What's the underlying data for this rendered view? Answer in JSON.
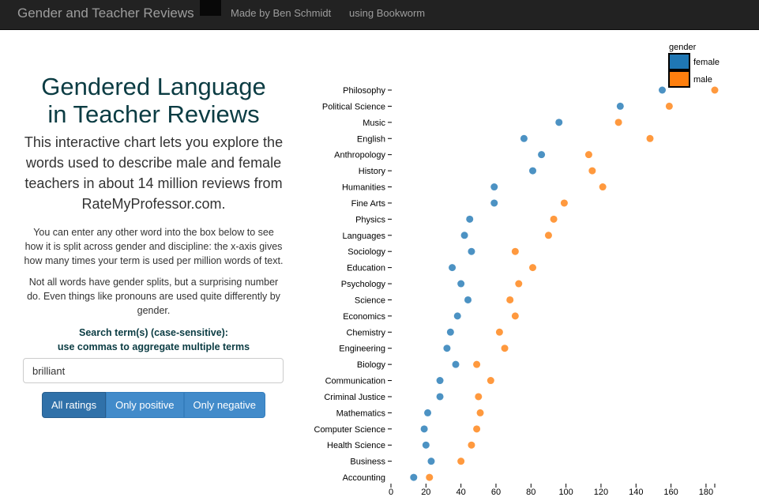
{
  "nav": {
    "brand": "Gender and Teacher Reviews",
    "links": [
      "Made by Ben Schmidt",
      "using Bookworm"
    ]
  },
  "intro": {
    "title_line1": "Gendered Language",
    "title_line2": "in Teacher Reviews",
    "lead": "This interactive chart lets you explore the words used to describe male and female teachers in about 14 million reviews from RateMyProfessor.com.",
    "p1": "You can enter any other word into the box below to see how it is split across gender and discipline: the x-axis gives how many times your term is used per million words of text.",
    "p2": "Not all words have gender splits, but a surprising number do. Even things like pronouns are used quite differently by gender.",
    "search_label1": "Search term(s) (case-sensitive):",
    "search_label2": "use commas to aggregate multiple terms",
    "search_value": "brilliant",
    "buttons": [
      "All ratings",
      "Only positive",
      "Only negative"
    ],
    "active_button": "All ratings"
  },
  "chart_data": {
    "type": "scatter",
    "legend_title": "gender",
    "legend_placement": "top-right",
    "xlim": [
      0,
      185
    ],
    "xticks": [
      0,
      20,
      40,
      60,
      80,
      100,
      120,
      140,
      160,
      180
    ],
    "categories": [
      "Philosophy",
      "Political Science",
      "Music",
      "English",
      "Anthropology",
      "History",
      "Humanities",
      "Fine Arts",
      "Physics",
      "Languages",
      "Sociology",
      "Education",
      "Psychology",
      "Science",
      "Economics",
      "Chemistry",
      "Engineering",
      "Biology",
      "Communication",
      "Criminal Justice",
      "Mathematics",
      "Computer Science",
      "Health Science",
      "Business",
      "Accounting"
    ],
    "series": [
      {
        "name": "female",
        "color": "#1f77b4",
        "values": [
          155,
          131,
          96,
          76,
          86,
          81,
          59,
          59,
          45,
          42,
          46,
          35,
          40,
          44,
          38,
          34,
          32,
          37,
          28,
          28,
          21,
          19,
          20,
          23,
          13
        ]
      },
      {
        "name": "male",
        "color": "#ff7f0e",
        "values": [
          185,
          159,
          130,
          148,
          113,
          115,
          121,
          99,
          93,
          90,
          71,
          81,
          73,
          68,
          71,
          62,
          65,
          49,
          57,
          50,
          51,
          49,
          46,
          40,
          22
        ]
      }
    ]
  }
}
